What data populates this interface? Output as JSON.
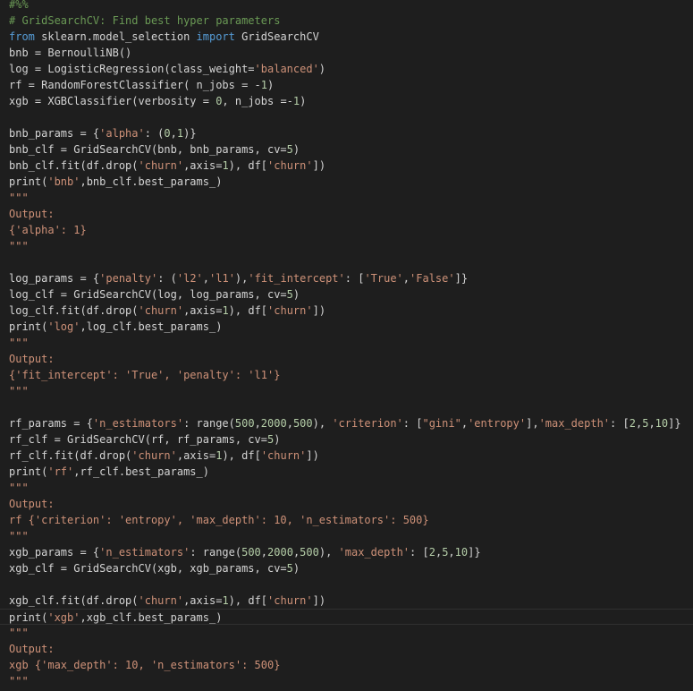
{
  "colors": {
    "background": "#1e1e1e",
    "default": "#d4d4d4",
    "comment": "#6a9955",
    "keyword": "#569cd6",
    "string": "#ce9178",
    "number": "#b5cea8"
  },
  "code_lines": [
    [
      [
        "comment",
        "#%%"
      ]
    ],
    [
      [
        "comment",
        "# GridSearchCV: Find best hyper parameters"
      ]
    ],
    [
      [
        "keyword",
        "from"
      ],
      [
        "default",
        " sklearn.model_selection "
      ],
      [
        "keyword",
        "import"
      ],
      [
        "default",
        " GridSearchCV"
      ]
    ],
    [
      [
        "default",
        "bnb = BernoulliNB()"
      ]
    ],
    [
      [
        "default",
        "log = LogisticRegression(class_weight="
      ],
      [
        "string",
        "'balanced'"
      ],
      [
        "default",
        ")"
      ]
    ],
    [
      [
        "default",
        "rf = RandomForestClassifier( n_jobs = -"
      ],
      [
        "number",
        "1"
      ],
      [
        "default",
        ")"
      ]
    ],
    [
      [
        "default",
        "xgb = XGBClassifier(verbosity = "
      ],
      [
        "number",
        "0"
      ],
      [
        "default",
        ", n_jobs =-"
      ],
      [
        "number",
        "1"
      ],
      [
        "default",
        ")"
      ]
    ],
    [],
    [
      [
        "default",
        "bnb_params = {"
      ],
      [
        "string",
        "'alpha'"
      ],
      [
        "default",
        ": ("
      ],
      [
        "number",
        "0"
      ],
      [
        "default",
        ","
      ],
      [
        "number",
        "1"
      ],
      [
        "default",
        ")}"
      ]
    ],
    [
      [
        "default",
        "bnb_clf = GridSearchCV(bnb, bnb_params, cv="
      ],
      [
        "number",
        "5"
      ],
      [
        "default",
        ")"
      ]
    ],
    [
      [
        "default",
        "bnb_clf.fit(df.drop("
      ],
      [
        "string",
        "'churn'"
      ],
      [
        "default",
        ",axis="
      ],
      [
        "number",
        "1"
      ],
      [
        "default",
        "), df["
      ],
      [
        "string",
        "'churn'"
      ],
      [
        "default",
        "])"
      ]
    ],
    [
      [
        "default",
        "print("
      ],
      [
        "string",
        "'bnb'"
      ],
      [
        "default",
        ",bnb_clf.best_params_)"
      ]
    ],
    [
      [
        "string",
        "\"\"\""
      ]
    ],
    [
      [
        "string",
        "Output:"
      ]
    ],
    [
      [
        "string",
        "{'alpha': 1}"
      ]
    ],
    [
      [
        "string",
        "\"\"\""
      ]
    ],
    [],
    [
      [
        "default",
        "log_params = {"
      ],
      [
        "string",
        "'penalty'"
      ],
      [
        "default",
        ": ("
      ],
      [
        "string",
        "'l2'"
      ],
      [
        "default",
        ","
      ],
      [
        "string",
        "'l1'"
      ],
      [
        "default",
        "),"
      ],
      [
        "string",
        "'fit_intercept'"
      ],
      [
        "default",
        ": ["
      ],
      [
        "string",
        "'True'"
      ],
      [
        "default",
        ","
      ],
      [
        "string",
        "'False'"
      ],
      [
        "default",
        "]}"
      ]
    ],
    [
      [
        "default",
        "log_clf = GridSearchCV(log, log_params, cv="
      ],
      [
        "number",
        "5"
      ],
      [
        "default",
        ")"
      ]
    ],
    [
      [
        "default",
        "log_clf.fit(df.drop("
      ],
      [
        "string",
        "'churn'"
      ],
      [
        "default",
        ",axis="
      ],
      [
        "number",
        "1"
      ],
      [
        "default",
        "), df["
      ],
      [
        "string",
        "'churn'"
      ],
      [
        "default",
        "])"
      ]
    ],
    [
      [
        "default",
        "print("
      ],
      [
        "string",
        "'log'"
      ],
      [
        "default",
        ",log_clf.best_params_)"
      ]
    ],
    [
      [
        "string",
        "\"\"\""
      ]
    ],
    [
      [
        "string",
        "Output:"
      ]
    ],
    [
      [
        "string",
        "{'fit_intercept': 'True', 'penalty': 'l1'}"
      ]
    ],
    [
      [
        "string",
        "\"\"\""
      ]
    ],
    [],
    [
      [
        "default",
        "rf_params = {"
      ],
      [
        "string",
        "'n_estimators'"
      ],
      [
        "default",
        ": range("
      ],
      [
        "number",
        "500"
      ],
      [
        "default",
        ","
      ],
      [
        "number",
        "2000"
      ],
      [
        "default",
        ","
      ],
      [
        "number",
        "500"
      ],
      [
        "default",
        "), "
      ],
      [
        "string",
        "'criterion'"
      ],
      [
        "default",
        ": ["
      ],
      [
        "string",
        "\"gini\""
      ],
      [
        "default",
        ","
      ],
      [
        "string",
        "'entropy'"
      ],
      [
        "default",
        "],"
      ],
      [
        "string",
        "'max_depth'"
      ],
      [
        "default",
        ": ["
      ],
      [
        "number",
        "2"
      ],
      [
        "default",
        ","
      ],
      [
        "number",
        "5"
      ],
      [
        "default",
        ","
      ],
      [
        "number",
        "10"
      ],
      [
        "default",
        "]}"
      ]
    ],
    [
      [
        "default",
        "rf_clf = GridSearchCV(rf, rf_params, cv="
      ],
      [
        "number",
        "5"
      ],
      [
        "default",
        ")"
      ]
    ],
    [
      [
        "default",
        "rf_clf.fit(df.drop("
      ],
      [
        "string",
        "'churn'"
      ],
      [
        "default",
        ",axis="
      ],
      [
        "number",
        "1"
      ],
      [
        "default",
        "), df["
      ],
      [
        "string",
        "'churn'"
      ],
      [
        "default",
        "])"
      ]
    ],
    [
      [
        "default",
        "print("
      ],
      [
        "string",
        "'rf'"
      ],
      [
        "default",
        ",rf_clf.best_params_)"
      ]
    ],
    [
      [
        "string",
        "\"\"\""
      ]
    ],
    [
      [
        "string",
        "Output:"
      ]
    ],
    [
      [
        "string",
        "rf {'criterion': 'entropy', 'max_depth': 10, 'n_estimators': 500}"
      ]
    ],
    [
      [
        "string",
        "\"\"\""
      ]
    ],
    [
      [
        "default",
        "xgb_params = {"
      ],
      [
        "string",
        "'n_estimators'"
      ],
      [
        "default",
        ": range("
      ],
      [
        "number",
        "500"
      ],
      [
        "default",
        ","
      ],
      [
        "number",
        "2000"
      ],
      [
        "default",
        ","
      ],
      [
        "number",
        "500"
      ],
      [
        "default",
        "), "
      ],
      [
        "string",
        "'max_depth'"
      ],
      [
        "default",
        ": ["
      ],
      [
        "number",
        "2"
      ],
      [
        "default",
        ","
      ],
      [
        "number",
        "5"
      ],
      [
        "default",
        ","
      ],
      [
        "number",
        "10"
      ],
      [
        "default",
        "]}"
      ]
    ],
    [
      [
        "default",
        "xgb_clf = GridSearchCV(xgb, xgb_params, cv="
      ],
      [
        "number",
        "5"
      ],
      [
        "default",
        ")"
      ]
    ],
    [],
    [
      [
        "default",
        "xgb_clf.fit(df.drop("
      ],
      [
        "string",
        "'churn'"
      ],
      [
        "default",
        ",axis="
      ],
      [
        "number",
        "1"
      ],
      [
        "default",
        "), df["
      ],
      [
        "string",
        "'churn'"
      ],
      [
        "default",
        "])"
      ]
    ],
    [
      [
        "default",
        "print("
      ],
      [
        "string",
        "'xgb'"
      ],
      [
        "default",
        ",xgb_clf.best_params_)"
      ]
    ],
    [
      [
        "string",
        "\"\"\""
      ]
    ],
    [
      [
        "string",
        "Output:"
      ]
    ],
    [
      [
        "string",
        "xgb {'max_depth': 10, 'n_estimators': 500}"
      ]
    ],
    [
      [
        "string",
        "\"\"\""
      ]
    ]
  ],
  "current_line": 38
}
